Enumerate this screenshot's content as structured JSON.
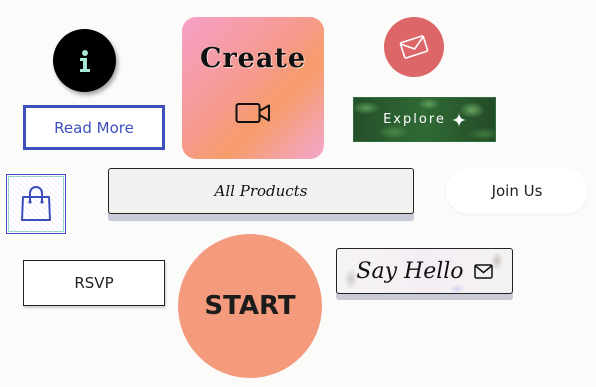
{
  "buttons": {
    "info_icon": "info-icon",
    "read_more": "Read More",
    "create": "Create",
    "create_icon": "video-camera-icon",
    "mail_icon": "envelope-icon",
    "explore": "Explore",
    "explore_icon": "sparkle-icon",
    "bag_icon": "shopping-bag-icon",
    "all_products": "All Products",
    "join_us": "Join Us",
    "rsvp": "RSVP",
    "start": "START",
    "say_hello": "Say Hello",
    "say_hello_icon": "envelope-icon"
  },
  "colors": {
    "accent_blue": "#3c4fbd",
    "mail_red": "#dc6668",
    "start_orange": "#f39b7c",
    "info_icon_mint": "#a8e6d6"
  }
}
